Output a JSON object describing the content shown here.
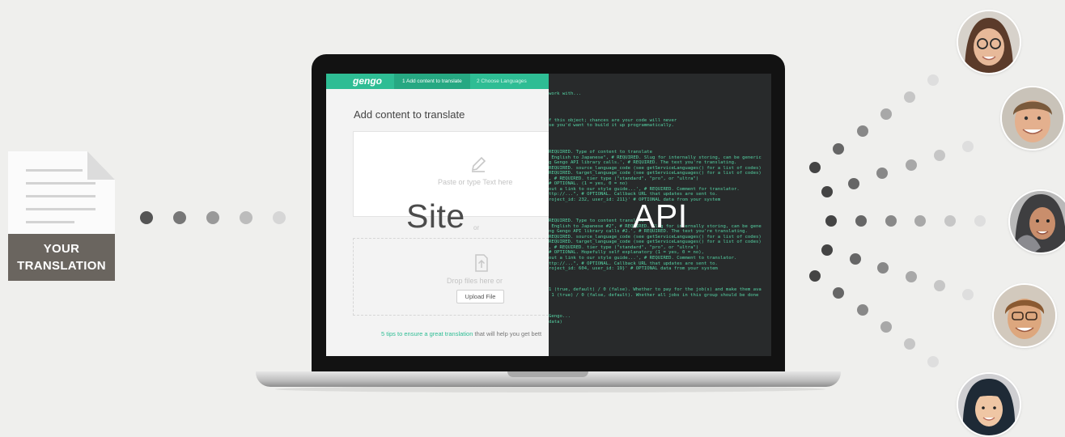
{
  "document_icon": {
    "line1": "YOUR",
    "line2": "TRANSLATION"
  },
  "app": {
    "logo": "gengo",
    "steps": [
      "1  Add content to translate",
      "2  Choose Languages"
    ],
    "heading": "Add content to translate",
    "paste_placeholder": "Paste or type Text here",
    "or": "or",
    "drop_text": "Drop files here or",
    "upload_button": "Upload File",
    "tips_link": "5 tips to ensure a great translation",
    "tips_rest": " that will help you get bett"
  },
  "overlay": {
    "site": "Site",
    "api": "API"
  },
  "code_lines": [
    "work with...",
    "",
    "",
    "",
    "",
    "f this object; chances are your code will never",
    "se you'd want to build it up programmatically.",
    "",
    "",
    "",
    "",
    "REQUIRED. Type of content to translate",
    " English to Japanese\", # REQUIRED. Slug for internally storing, can be generic",
    "g Gengo API library calls.', # REQUIRED. The text you're translating.",
    "REQUIRED. source_language_code (see getServiceLanguages() for a list of codes)",
    "REQUIRED. target_language_code (see getServiceLanguages() for a list of codes)",
    ", # REQUIRED. tier type (\"standard\", \"pro\", or \"ultra\")",
    "# OPTIONAL. (1 = yes, 0 = no)",
    "out a link to our style guide...', # REQUIRED. Comment for translator.",
    "ttp://...\", # OPTIONAL. Callback URL that updates are sent to.",
    "roject_id: 232, user_id: 211}' # OPTIONAL data from your system",
    "",
    "",
    "",
    "REQUIRED. Type to content translate",
    " English to Japanese #2\", # REQUIRED. Slug for internally storing, can be gene",
    "ng Gengo API library calls #2.', # REQUIRED. The text you're translating.",
    "REQUIRED. source_language_code (see getServiceLanguages() for a list of codes)",
    "REQUIRED. target_language_code (see getServiceLanguages() for a list of codes)",
    ", # REQUIRED. tier type (\"standard\", \"pro\", or \"ultra\")",
    "# OPTIONAL. Hopefully self explanatory (1 = yes, 0 = no),",
    "out a link to our style guide...', # REQUIRED. Comment to translator.",
    "ttp://...\", # OPTIONAL. Callback URL that updates are sent to.",
    "roject_id: 604, user_id: 19}' # OPTIONAL data from your system",
    "",
    "",
    "",
    "1 (true, default) / 0 (false). Whether to pay for the job(s) and make them ava",
    " 1 (true) / 0 (false, default). Whether all jobs in this group should be done",
    "",
    "",
    "",
    "Gengo...",
    "data)"
  ],
  "colors": {
    "accent": "#2ebd94",
    "code": "#55d3a4",
    "background": "#efefed",
    "label_bg": "#6a655f"
  }
}
